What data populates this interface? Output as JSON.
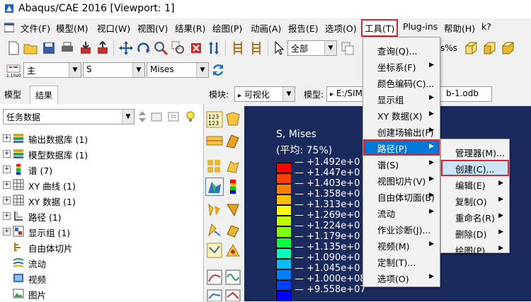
{
  "title": "Abaqus/CAE 2016 [Viewport: 1]",
  "menubar": [
    "文件(F)",
    "模型(M)",
    "视口(W)",
    "视图(V)",
    "结果(R)",
    "绘图(P)",
    "动画(A)",
    "报告(E)",
    "选项(O)",
    "工具(T)",
    "Plug-ins",
    "帮助(H)",
    "k?"
  ],
  "toolbar": {
    "select_value": "全部",
    "zoom_label": "s%s"
  },
  "toolbar2": {
    "step_value": "主",
    "field_value": "S",
    "invariant_value": "Mises"
  },
  "left": {
    "tabs": [
      "模型",
      "结果"
    ],
    "task_combo": "任务数据",
    "tree": [
      {
        "label": "输出数据库 (1)",
        "icon": "database-icon",
        "expand": true
      },
      {
        "label": "模型数据库 (1)",
        "icon": "database-icon",
        "expand": true
      },
      {
        "label": "谱 (7)",
        "icon": "spectrum-icon",
        "expand": true
      },
      {
        "label": "XY 曲线 (1)",
        "icon": "grid-icon",
        "expand": true
      },
      {
        "label": "XY 数据 (1)",
        "icon": "grid-icon",
        "expand": true
      },
      {
        "label": "路径 (1)",
        "icon": "path-icon",
        "expand": true
      },
      {
        "label": "显示组 (1)",
        "icon": "display-group-icon",
        "expand": true
      },
      {
        "label": "自由体切片",
        "icon": "freebody-icon",
        "expand": false
      },
      {
        "label": "流动",
        "icon": "flow-icon",
        "expand": false
      },
      {
        "label": "视频",
        "icon": "video-icon",
        "expand": false
      },
      {
        "label": "图片",
        "icon": "picture-icon",
        "expand": false
      }
    ]
  },
  "context_bar": {
    "module_label": "模块:",
    "module_value": "可视化",
    "model_label": "模型:",
    "model_value": "E:/SIM",
    "odb_suffix": "b-1.odb"
  },
  "legend": {
    "title1": "S, Mises",
    "title2": "(平均: 75%)",
    "values": [
      "+1.492e+0",
      "+1.447e+0",
      "+1.403e+0",
      "+1.358e+0",
      "+1.313e+0",
      "+1.269e+0",
      "+1.224e+0",
      "+1.179e+0",
      "+1.135e+0",
      "+1.090e+0",
      "+1.045e+0",
      "+1.000e+08",
      "+9.558e+07"
    ],
    "colors": [
      "#ff0000",
      "#ff4000",
      "#ff8000",
      "#ffbf00",
      "#ffff00",
      "#bfff00",
      "#80ff00",
      "#00ff40",
      "#00ffbf",
      "#00bfff",
      "#0080ff",
      "#0040ff",
      "#0000ff"
    ]
  },
  "tools_menu": [
    {
      "label": "查询(Q)...",
      "sub": false
    },
    {
      "label": "坐标系(F)",
      "sub": true
    },
    {
      "label": "颜色编码(C)...",
      "sub": false
    },
    {
      "label": "显示组",
      "sub": true
    },
    {
      "label": "XY 数据(X)",
      "sub": true
    },
    {
      "label": "创建场输出(F)",
      "sub": true
    },
    {
      "label": "路径(P)",
      "sub": true
    },
    {
      "label": "谱(S)",
      "sub": true
    },
    {
      "label": "视图切片(V)",
      "sub": true
    },
    {
      "label": "自由体切面(B)",
      "sub": true
    },
    {
      "label": "流动",
      "sub": true
    },
    {
      "label": "作业诊断(J)...",
      "sub": false
    },
    {
      "label": "视频(M)",
      "sub": true
    },
    {
      "label": "定制(T)...",
      "sub": false
    },
    {
      "label": "选项(O)",
      "sub": true
    }
  ],
  "path_menu": [
    {
      "label": "管理器(M)...",
      "sub": false
    },
    {
      "label": "创建(C)...",
      "sub": false
    },
    {
      "label": "编辑(E)",
      "sub": true
    },
    {
      "label": "复制(O)",
      "sub": true
    },
    {
      "label": "重命名(R)",
      "sub": true
    },
    {
      "label": "删除(D)",
      "sub": true
    },
    {
      "label": "绘图(P)",
      "sub": true
    }
  ]
}
